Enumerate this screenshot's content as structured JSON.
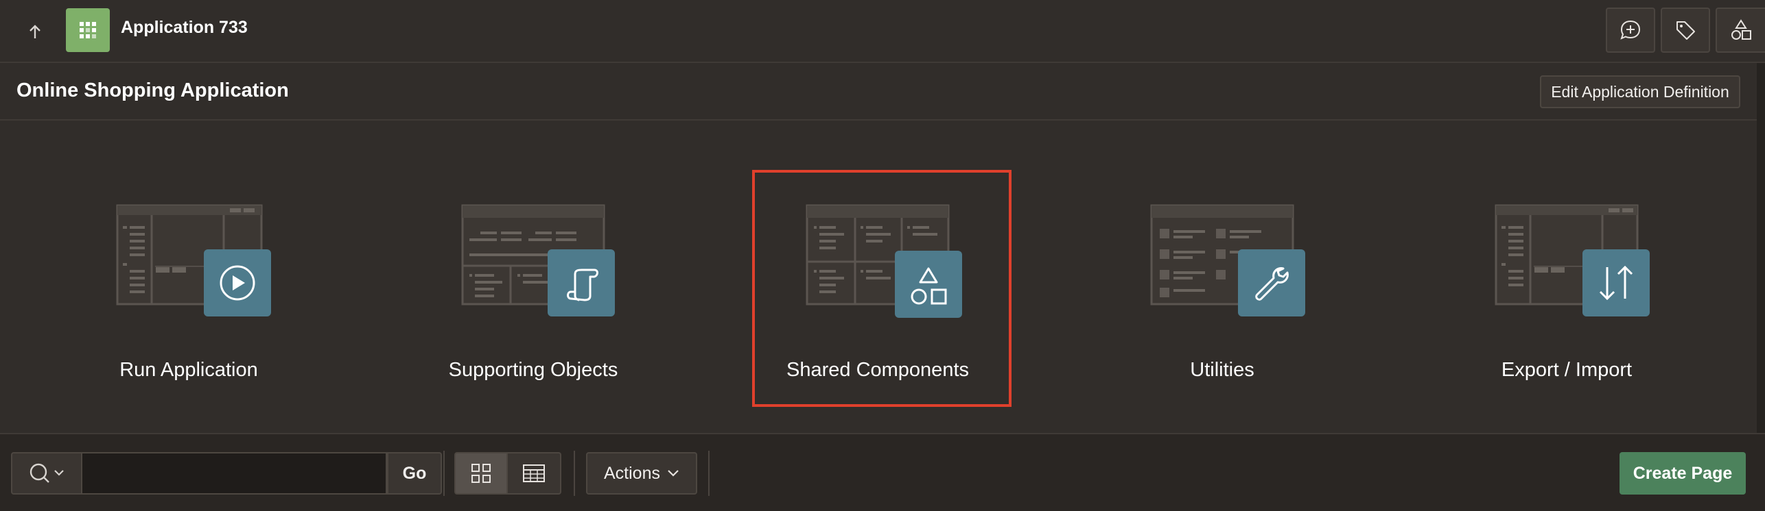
{
  "topbar": {
    "app_title": "Application 733",
    "icons": [
      "up-arrow-icon",
      "app-grid-icon",
      "feedback-icon",
      "tag-icon",
      "shared-components-icon"
    ]
  },
  "header": {
    "title": "Online Shopping Application",
    "edit_button": "Edit Application Definition"
  },
  "cards": [
    {
      "label": "Run Application",
      "icon": "play-icon"
    },
    {
      "label": "Supporting Objects",
      "icon": "scroll-icon"
    },
    {
      "label": "Shared Components",
      "icon": "shapes-icon",
      "highlighted": true
    },
    {
      "label": "Utilities",
      "icon": "wrench-icon"
    },
    {
      "label": "Export / Import",
      "icon": "transfer-arrows-icon"
    }
  ],
  "toolbar": {
    "search_placeholder": "",
    "go_label": "Go",
    "actions_label": "Actions",
    "create_label": "Create Page",
    "view_mode": "icons"
  },
  "colors": {
    "background": "#312d2a",
    "app_badge": "#7fb069",
    "card_icon_tile": "#4e7b8c",
    "highlight": "#e0402c",
    "create_button": "#4c825c"
  }
}
